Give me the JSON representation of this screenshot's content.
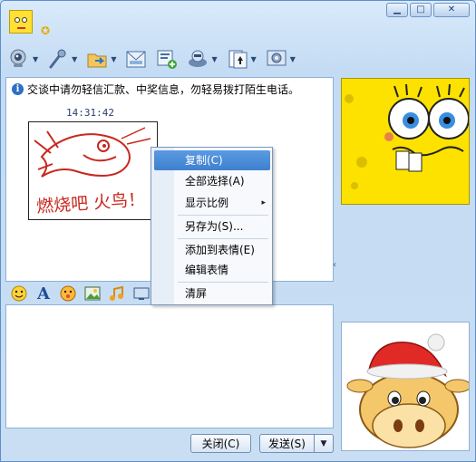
{
  "window": {
    "buttons": {
      "minimize": "▁",
      "maximize": "□",
      "close": "✕"
    }
  },
  "toolbar": {
    "icons": [
      "webcam-icon",
      "microphone-icon",
      "file-transfer-icon",
      "mail-icon",
      "sms-icon",
      "app-icon",
      "game-icon",
      "settings-icon"
    ]
  },
  "chat": {
    "notice": "交谈中请勿轻信汇款、中奖信息，勿轻易拨打陌生电话。",
    "time": "14:31:42",
    "sticker_text": "燃烧吧 火鸟！"
  },
  "context_menu": {
    "items": [
      {
        "label": "复制(C)"
      },
      {
        "label": "全部选择(A)"
      },
      {
        "label": "显示比例"
      },
      {
        "label": "另存为(S)..."
      },
      {
        "label": "添加到表情(E)"
      },
      {
        "label": "编辑表情"
      },
      {
        "label": "清屏"
      }
    ],
    "highlighted": "复制(C)",
    "submenu_arrow": "▸"
  },
  "bottom": {
    "close_label": "关闭(C)",
    "send_label": "发送(S)",
    "send_dropdown": "▼"
  },
  "sidebar": {
    "collapse": "‹"
  },
  "colors": {
    "accent": "#3f80cf",
    "frame": "#c9def3",
    "sponge": "#fde200"
  }
}
